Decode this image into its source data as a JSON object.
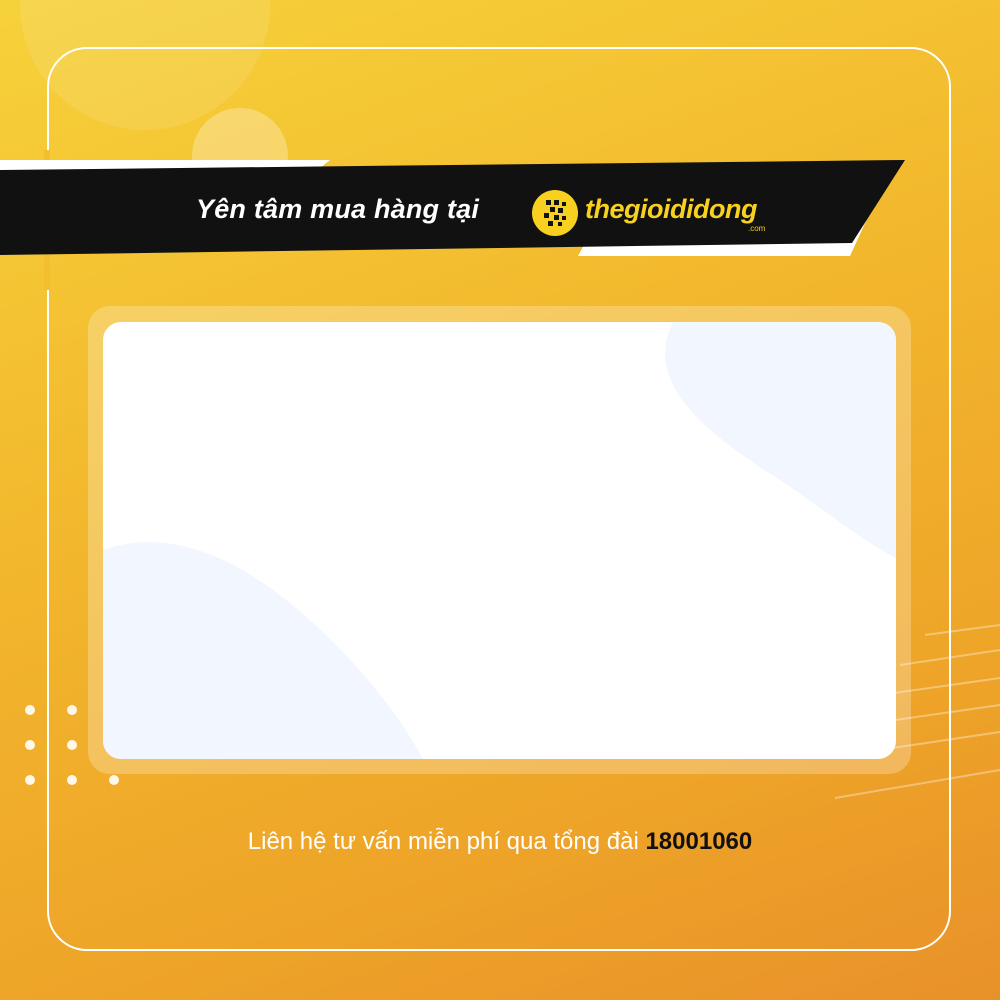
{
  "banner": {
    "tagline": "Yên tâm mua hàng tại",
    "brand_name": "thegioididong",
    "brand_suffix": ".com",
    "brand_icon": "running-man-icon"
  },
  "footer": {
    "text": "Liên hệ tư vấn miễn phí qua tổng đài",
    "hotline": "18001060"
  },
  "colors": {
    "background_top": "#f6d23a",
    "background_bottom": "#e8912a",
    "banner": "#111111",
    "brand_yellow": "#f8d020",
    "card": "#ffffff",
    "card_accent": "#f2f6fe"
  }
}
